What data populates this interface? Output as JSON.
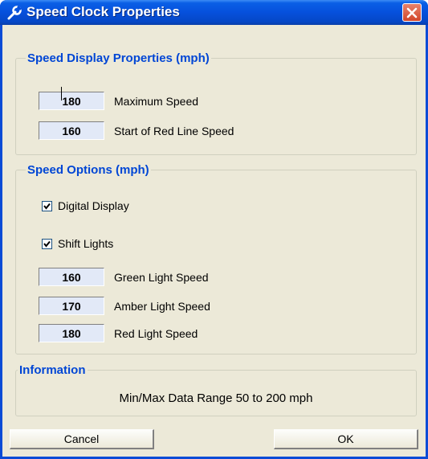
{
  "window": {
    "title": "Speed Clock Properties"
  },
  "display_group": {
    "legend": "Speed Display Properties (mph)",
    "max_speed": {
      "value": "180",
      "label": "Maximum Speed"
    },
    "redline_speed": {
      "value": "160",
      "label": "Start of Red Line Speed"
    }
  },
  "options_group": {
    "legend": "Speed Options (mph)",
    "digital_display": {
      "label": "Digital Display",
      "checked": true
    },
    "shift_lights": {
      "label": "Shift Lights",
      "checked": true
    },
    "green_speed": {
      "value": "160",
      "label": "Green Light Speed"
    },
    "amber_speed": {
      "value": "170",
      "label": "Amber Light Speed"
    },
    "red_speed": {
      "value": "180",
      "label": "Red Light Speed"
    }
  },
  "info_group": {
    "legend": "Information",
    "text": "Min/Max Data Range 50 to 200 mph"
  },
  "buttons": {
    "cancel": "Cancel",
    "ok": "OK"
  },
  "icons": {
    "title": "wrench-icon",
    "close": "close-icon",
    "check": "checkmark-icon"
  },
  "colors": {
    "title_bar": "#0650dc",
    "legend_text": "#0046d5",
    "field_bg": "#e2e9f7",
    "dialog_bg": "#ece9d8",
    "close_button": "#d3462a"
  }
}
